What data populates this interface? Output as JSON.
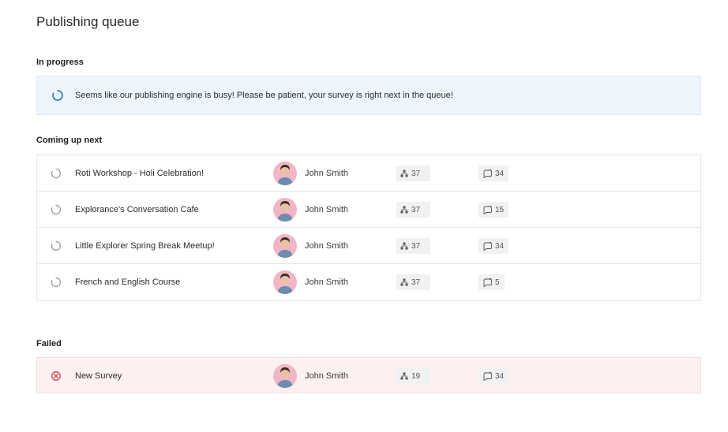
{
  "page": {
    "title": "Publishing queue"
  },
  "in_progress": {
    "heading": "In progress",
    "message": "Seems like our publishing engine is busy! Please be patient, your survey is  right next in the queue!"
  },
  "coming_up": {
    "heading": "Coming up next",
    "items": [
      {
        "title": "Roti Workshop - Holi Celebration!",
        "author": "John Smith",
        "responses": "37",
        "questions": "34"
      },
      {
        "title": "Explorance's Conversation Cafe",
        "author": "John Smith",
        "responses": "37",
        "questions": "15"
      },
      {
        "title": "Little Explorer Spring Break Meetup!",
        "author": "John Smith",
        "responses": "37",
        "questions": "34"
      },
      {
        "title": "French and English Course",
        "author": "John Smith",
        "responses": "37",
        "questions": "5"
      }
    ]
  },
  "failed": {
    "heading": "Failed",
    "items": [
      {
        "title": "New Survey",
        "author": "John Smith",
        "responses": "19",
        "questions": "34"
      }
    ]
  },
  "colors": {
    "accent_blue": "#2f7fd3",
    "banner_bg": "#eef5fc",
    "failed_bg": "#fdf0f0",
    "error_red": "#e0434f",
    "chip_bg": "#f0f1f3"
  },
  "icons": {
    "banner": "loading-spinner-icon",
    "queued": "pending-spinner-icon",
    "failed": "error-circle-icon",
    "responses": "hierarchy-icon",
    "questions": "question-bubble-icon",
    "avatar": "user-avatar"
  }
}
